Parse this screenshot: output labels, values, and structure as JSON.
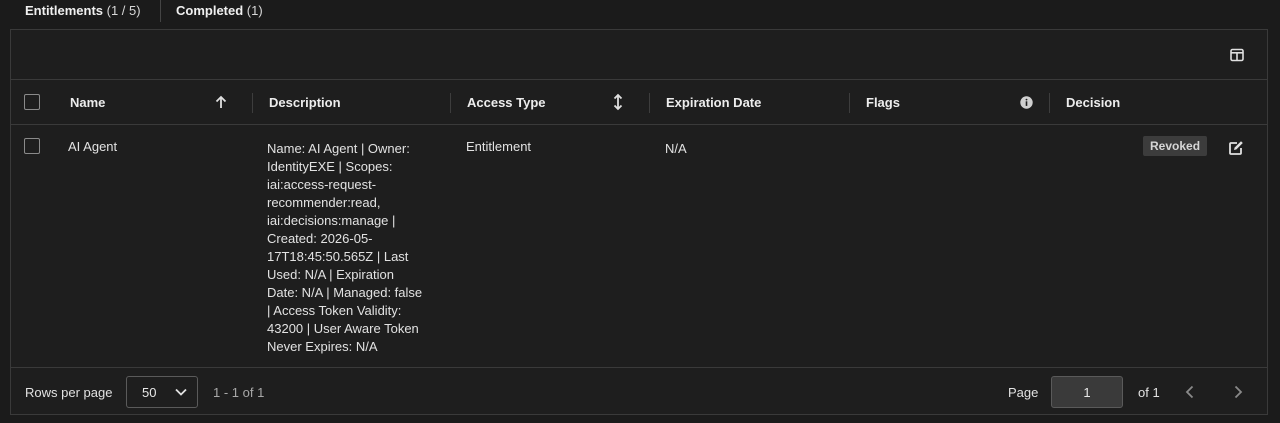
{
  "tabs": [
    {
      "label": "Entitlements",
      "count": "(1 / 5)"
    },
    {
      "label": "Completed",
      "count": "(1)"
    }
  ],
  "toolbar": {
    "columns_icon": "columns-icon"
  },
  "table": {
    "headers": {
      "name": "Name",
      "description": "Description",
      "access_type": "Access Type",
      "expiration_date": "Expiration Date",
      "flags": "Flags",
      "decision": "Decision"
    },
    "sort_icons": {
      "name": "arrow-up-icon",
      "access_type": "sort-vertical-icon"
    },
    "flags_info_icon": "info-icon",
    "rows": [
      {
        "name": "AI Agent",
        "description_lines": [
          "Name: AI Agent | Owner:",
          "IdentityEXE | Scopes:",
          "iai:access-request-",
          "recommender:read,",
          "iai:decisions:manage |",
          "Created: 2026-05-",
          "17T18:45:50.565Z | Last",
          "Used: N/A | Expiration",
          "Date: N/A | Managed: false",
          "| Access Token Validity:",
          "43200 | User Aware Token",
          "Never Expires: N/A"
        ],
        "access_type": "Entitlement",
        "expiration_date": "N/A",
        "flags": "",
        "decision": "Revoked",
        "edit_icon": "edit-icon"
      }
    ]
  },
  "footer": {
    "rows_per_page_label": "Rows per page",
    "rows_per_page_value": "50",
    "range": "1 - 1 of 1",
    "page_label": "Page",
    "page_value": "1",
    "of_label": "of 1"
  }
}
